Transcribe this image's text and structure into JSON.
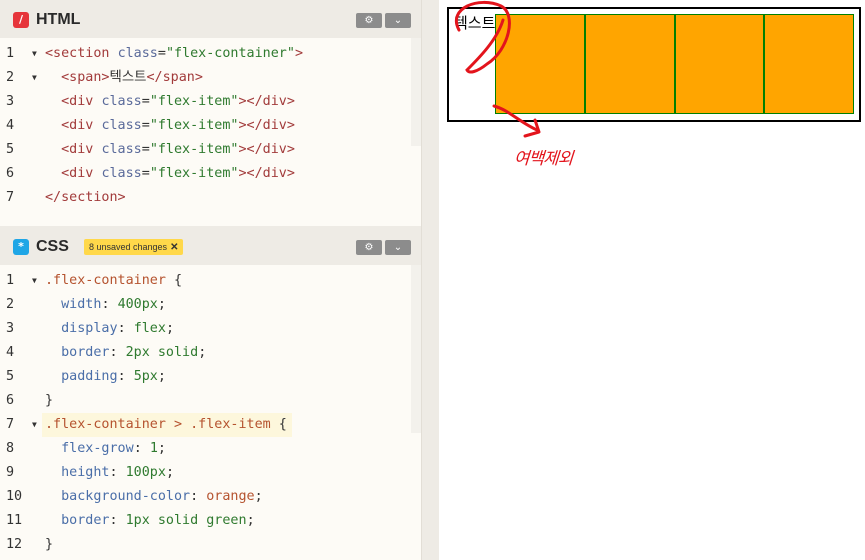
{
  "html_panel": {
    "title": "HTML",
    "icon": "/",
    "lines": [
      {
        "n": "1",
        "fold": true,
        "parts": [
          [
            "c-tag",
            "<section "
          ],
          [
            "c-attr",
            "class"
          ],
          [
            "c-plain",
            "="
          ],
          [
            "c-str",
            "\"flex-container\""
          ],
          [
            "c-tag",
            ">"
          ]
        ]
      },
      {
        "n": "2",
        "fold": true,
        "parts": [
          [
            "c-plain",
            "  "
          ],
          [
            "c-tag",
            "<span>"
          ],
          [
            "c-plain",
            "텍스트"
          ],
          [
            "c-tag",
            "</span>"
          ]
        ]
      },
      {
        "n": "3",
        "fold": false,
        "parts": [
          [
            "c-plain",
            "  "
          ],
          [
            "c-tag",
            "<div "
          ],
          [
            "c-attr",
            "class"
          ],
          [
            "c-plain",
            "="
          ],
          [
            "c-str",
            "\"flex-item\""
          ],
          [
            "c-tag",
            "></div>"
          ]
        ]
      },
      {
        "n": "4",
        "fold": false,
        "parts": [
          [
            "c-plain",
            "  "
          ],
          [
            "c-tag",
            "<div "
          ],
          [
            "c-attr",
            "class"
          ],
          [
            "c-plain",
            "="
          ],
          [
            "c-str",
            "\"flex-item\""
          ],
          [
            "c-tag",
            "></div>"
          ]
        ]
      },
      {
        "n": "5",
        "fold": false,
        "parts": [
          [
            "c-plain",
            "  "
          ],
          [
            "c-tag",
            "<div "
          ],
          [
            "c-attr",
            "class"
          ],
          [
            "c-plain",
            "="
          ],
          [
            "c-str",
            "\"flex-item\""
          ],
          [
            "c-tag",
            "></div>"
          ]
        ]
      },
      {
        "n": "6",
        "fold": false,
        "parts": [
          [
            "c-plain",
            "  "
          ],
          [
            "c-tag",
            "<div "
          ],
          [
            "c-attr",
            "class"
          ],
          [
            "c-plain",
            "="
          ],
          [
            "c-str",
            "\"flex-item\""
          ],
          [
            "c-tag",
            "></div>"
          ]
        ]
      },
      {
        "n": "7",
        "fold": false,
        "parts": [
          [
            "c-tag",
            "</section>"
          ]
        ]
      }
    ]
  },
  "css_panel": {
    "title": "CSS",
    "icon": "*",
    "unsaved": "8 unsaved changes",
    "unsaved_close": "✕",
    "lines": [
      {
        "n": "1",
        "fold": true,
        "parts": [
          [
            "c-sel",
            ".flex-container"
          ],
          [
            "c-plain",
            " {"
          ]
        ]
      },
      {
        "n": "2",
        "fold": false,
        "parts": [
          [
            "c-plain",
            "  "
          ],
          [
            "c-prop",
            "width"
          ],
          [
            "c-plain",
            ": "
          ],
          [
            "c-val",
            "400px"
          ],
          [
            "c-plain",
            ";"
          ]
        ]
      },
      {
        "n": "3",
        "fold": false,
        "parts": [
          [
            "c-plain",
            "  "
          ],
          [
            "c-prop",
            "display"
          ],
          [
            "c-plain",
            ": "
          ],
          [
            "c-val",
            "flex"
          ],
          [
            "c-plain",
            ";"
          ]
        ]
      },
      {
        "n": "4",
        "fold": false,
        "parts": [
          [
            "c-plain",
            "  "
          ],
          [
            "c-prop",
            "border"
          ],
          [
            "c-plain",
            ": "
          ],
          [
            "c-val",
            "2px solid"
          ],
          [
            "c-plain",
            ";"
          ]
        ]
      },
      {
        "n": "5",
        "fold": false,
        "parts": [
          [
            "c-plain",
            "  "
          ],
          [
            "c-prop",
            "padding"
          ],
          [
            "c-plain",
            ": "
          ],
          [
            "c-val",
            "5px"
          ],
          [
            "c-plain",
            ";"
          ]
        ]
      },
      {
        "n": "6",
        "fold": false,
        "parts": [
          [
            "c-plain",
            "}"
          ]
        ]
      },
      {
        "n": "7",
        "fold": true,
        "parts": [
          [
            "c-sel",
            ".flex-container > .flex-item"
          ],
          [
            "c-plain",
            " {"
          ]
        ]
      },
      {
        "n": "8",
        "fold": false,
        "parts": [
          [
            "c-plain",
            "  "
          ],
          [
            "c-prop",
            "flex-grow"
          ],
          [
            "c-plain",
            ": "
          ],
          [
            "c-val",
            "1"
          ],
          [
            "c-plain",
            ";"
          ]
        ]
      },
      {
        "n": "9",
        "fold": false,
        "parts": [
          [
            "c-plain",
            "  "
          ],
          [
            "c-prop",
            "height"
          ],
          [
            "c-plain",
            ": "
          ],
          [
            "c-val",
            "100px"
          ],
          [
            "c-plain",
            ";"
          ]
        ]
      },
      {
        "n": "10",
        "fold": false,
        "parts": [
          [
            "c-plain",
            "  "
          ],
          [
            "c-prop",
            "background-color"
          ],
          [
            "c-plain",
            ": "
          ],
          [
            "c-sel",
            "orange"
          ],
          [
            "c-plain",
            ";"
          ]
        ]
      },
      {
        "n": "11",
        "fold": false,
        "parts": [
          [
            "c-plain",
            "  "
          ],
          [
            "c-prop",
            "border"
          ],
          [
            "c-plain",
            ": "
          ],
          [
            "c-val",
            "1px solid green"
          ],
          [
            "c-plain",
            ";"
          ]
        ]
      },
      {
        "n": "12",
        "fold": false,
        "parts": [
          [
            "c-plain",
            "}"
          ]
        ]
      }
    ]
  },
  "toolbar": {
    "settings_icon": "gear-icon",
    "collapse_icon": "chevron-down-icon"
  },
  "preview": {
    "span_text": "텍스트",
    "item_count": 4,
    "item_color": "#ffa500",
    "item_border_color": "#008000",
    "annotation_text": "여백제외",
    "annotation_color": "#e3141c"
  }
}
